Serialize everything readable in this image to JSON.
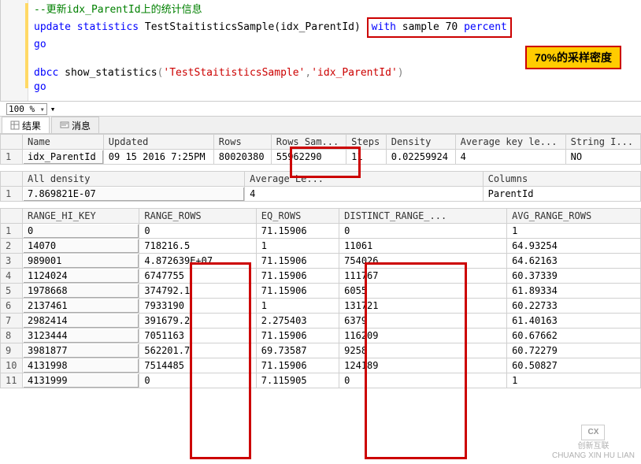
{
  "code": {
    "line1_comment": "--更新idx_ParentId上的统计信息",
    "line2_update": "update",
    "line2_statistics": "statistics",
    "line2_rest": " TestStaitisticsSample(idx_ParentId) ",
    "line2_with": "with",
    "line2_sample": " sample ",
    "line2_70": "70",
    "line2_percent": " percent",
    "line3_go": "go",
    "line5_dbcc": "dbcc",
    "line5_func": " show_statistics",
    "line5_paren1": "(",
    "line5_arg1": "'TestStaitisticsSample'",
    "line5_comma": ",",
    "line5_arg2": "'idx_ParentId'",
    "line5_paren2": ")",
    "line6_go": "go"
  },
  "callout": "70%的采样密度",
  "zoom": "100 %",
  "tabs": {
    "results": "结果",
    "messages": "消息"
  },
  "grid1": {
    "headers": [
      "Name",
      "Updated",
      "Rows",
      "Rows Sam...",
      "Steps",
      "Density",
      "Average key le...",
      "String I..."
    ],
    "rows": [
      {
        "n": "1",
        "cells": [
          "idx_ParentId",
          "09 15 2016  7:25PM",
          "80020380",
          "55962290",
          "11",
          "0.02259924",
          "4",
          "NO"
        ]
      }
    ]
  },
  "grid2": {
    "headers": [
      "All density",
      "Average Le...",
      "Columns"
    ],
    "rows": [
      {
        "n": "1",
        "cells": [
          "7.869821E-07",
          "4",
          "ParentId"
        ]
      }
    ]
  },
  "grid3": {
    "headers": [
      "RANGE_HI_KEY",
      "RANGE_ROWS",
      "EQ_ROWS",
      "DISTINCT_RANGE_...",
      "AVG_RANGE_ROWS"
    ],
    "rows": [
      {
        "n": "1",
        "cells": [
          "0",
          "0",
          "71.15906",
          "0",
          "1"
        ]
      },
      {
        "n": "2",
        "cells": [
          "14070",
          "718216.5",
          "1",
          "11061",
          "64.93254"
        ]
      },
      {
        "n": "3",
        "cells": [
          "989001",
          "4.872639E+07",
          "71.15906",
          "754026",
          "64.62163"
        ]
      },
      {
        "n": "4",
        "cells": [
          "1124024",
          "6747755",
          "71.15906",
          "111767",
          "60.37339"
        ]
      },
      {
        "n": "5",
        "cells": [
          "1978668",
          "374792.1",
          "71.15906",
          "6055",
          "61.89334"
        ]
      },
      {
        "n": "6",
        "cells": [
          "2137461",
          "7933190",
          "1",
          "131721",
          "60.22733"
        ]
      },
      {
        "n": "7",
        "cells": [
          "2982414",
          "391679.2",
          "2.275403",
          "6379",
          "61.40163"
        ]
      },
      {
        "n": "8",
        "cells": [
          "3123444",
          "7051163",
          "71.15906",
          "116209",
          "60.67662"
        ]
      },
      {
        "n": "9",
        "cells": [
          "3981877",
          "562201.7",
          "69.73587",
          "9258",
          "60.72279"
        ]
      },
      {
        "n": "10",
        "cells": [
          "4131998",
          "7514485",
          "71.15906",
          "124189",
          "60.50827"
        ]
      },
      {
        "n": "11",
        "cells": [
          "4131999",
          "0",
          "7.115905",
          "0",
          "1"
        ]
      }
    ]
  },
  "watermark": {
    "logo": "CX",
    "text1": "创新互联",
    "text2": "CHUANG XIN HU LIAN"
  }
}
